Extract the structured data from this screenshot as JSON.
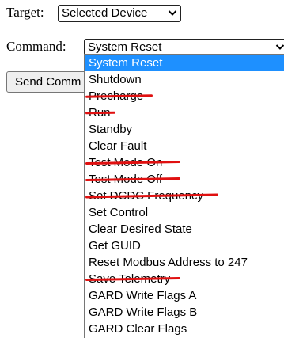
{
  "target": {
    "label": "Target:",
    "selected": "Selected Device"
  },
  "command": {
    "label": "Command:",
    "selected": "System Reset",
    "options": [
      {
        "label": "System Reset",
        "selected": true
      },
      {
        "label": "Shutdown"
      },
      {
        "label": "Precharge",
        "struck": true
      },
      {
        "label": "Run",
        "struck": true
      },
      {
        "label": "Standby"
      },
      {
        "label": "Clear Fault"
      },
      {
        "label": "Test Mode On",
        "struck": true
      },
      {
        "label": "Test Mode Off",
        "struck": true
      },
      {
        "label": "Set DCDC Frequency",
        "struck": true
      },
      {
        "label": "Set Control"
      },
      {
        "label": "Clear Desired State"
      },
      {
        "label": "Get GUID"
      },
      {
        "label": "Reset Modbus Address to 247"
      },
      {
        "label": "Save Telemetry",
        "struck": true
      },
      {
        "label": "GARD Write Flags A"
      },
      {
        "label": "GARD Write Flags B"
      },
      {
        "label": "GARD Clear Flags"
      }
    ]
  },
  "send_button": {
    "label": "Send Comm"
  },
  "colors": {
    "highlight": "#1e90ff",
    "strike": "#e01010"
  }
}
